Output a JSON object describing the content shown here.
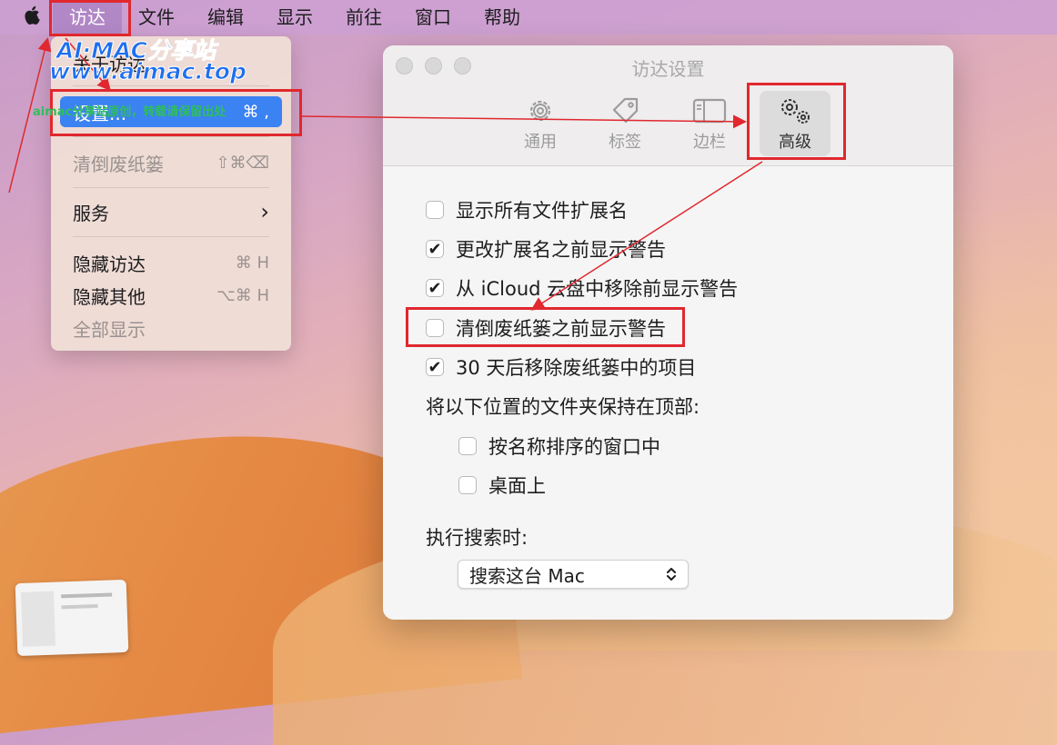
{
  "menubar": {
    "apple_icon": "apple-logo",
    "items": [
      "访达",
      "文件",
      "编辑",
      "显示",
      "前往",
      "窗口",
      "帮助"
    ]
  },
  "dropdown": {
    "about": "关于访达",
    "settings": {
      "label": "设置...",
      "shortcut": "⌘ ,"
    },
    "empty_trash": {
      "label": "清倒废纸篓",
      "shortcut": "⇧⌘⌫"
    },
    "services": {
      "label": "服务",
      "arrow": "›"
    },
    "hide": {
      "label": "隐藏访达",
      "shortcut": "⌘ H"
    },
    "hide_others": {
      "label": "隐藏其他",
      "shortcut": "⌥⌘ H"
    },
    "show_all": "全部显示"
  },
  "settings_window": {
    "title": "访达设置",
    "tabs": [
      {
        "label": "通用",
        "icon": "gear-icon"
      },
      {
        "label": "标签",
        "icon": "tag-icon"
      },
      {
        "label": "边栏",
        "icon": "sidebar-icon"
      },
      {
        "label": "高级",
        "icon": "gears-icon",
        "selected": true
      }
    ],
    "options": [
      {
        "label": "显示所有文件扩展名",
        "checked": false
      },
      {
        "label": "更改扩展名之前显示警告",
        "checked": true
      },
      {
        "label": "从 iCloud 云盘中移除前显示警告",
        "checked": true
      },
      {
        "label": "清倒废纸篓之前显示警告",
        "checked": false
      },
      {
        "label": "30 天后移除废纸篓中的项目",
        "checked": true
      }
    ],
    "folders_on_top_label": "将以下位置的文件夹保持在顶部:",
    "folder_options": [
      {
        "label": "按名称排序的窗口中",
        "checked": false
      },
      {
        "label": "桌面上",
        "checked": false
      }
    ],
    "search_label": "执行搜索时:",
    "search_select": {
      "value": "搜索这台 Mac",
      "icon": "updown-chevron-icon"
    }
  },
  "watermark": {
    "line1": "AI·MAC分享站",
    "line2": "www.aimac.top",
    "overlay": "aimac分享站原创，转载请保留出处"
  },
  "colors": {
    "annotation_red": "#e0282e",
    "highlight_blue": "#3b82f2"
  }
}
